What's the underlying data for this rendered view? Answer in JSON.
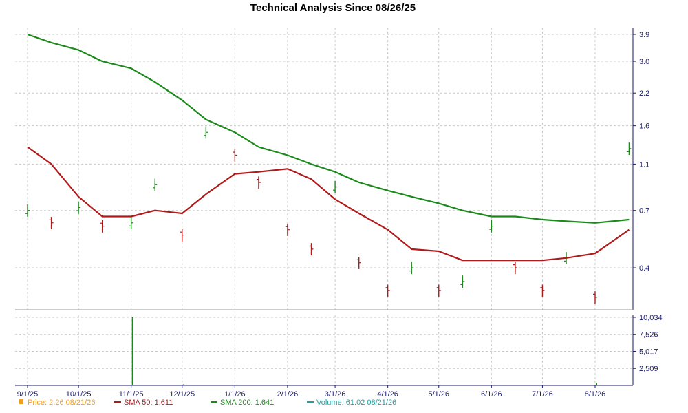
{
  "chart_data": {
    "type": "line",
    "title": "Technical Analysis Since 08/26/25",
    "price_axis": {
      "scale": "log",
      "ticks": [
        {
          "value": 0.4,
          "label": "0.4"
        },
        {
          "value": 0.7,
          "label": "0.7"
        },
        {
          "value": 1.1,
          "label": "1.1"
        },
        {
          "value": 1.6,
          "label": "1.6"
        },
        {
          "value": 2.2,
          "label": "2.2"
        },
        {
          "value": 3.0,
          "label": "3.0"
        },
        {
          "value": 3.9,
          "label": "3.9"
        }
      ]
    },
    "volume_axis": {
      "ticks": [
        {
          "value": 2509,
          "label": "2,509"
        },
        {
          "value": 5017,
          "label": "5,017"
        },
        {
          "value": 7526,
          "label": "7,526"
        },
        {
          "value": 10034,
          "label": "10,034"
        }
      ]
    },
    "date_axis": {
      "ticks": [
        "9/1/25",
        "10/1/25",
        "11/1/25",
        "12/1/25",
        "1/1/26",
        "2/1/26",
        "3/1/26",
        "4/1/26",
        "5/1/26",
        "6/1/26",
        "7/1/26",
        "8/1/26"
      ]
    },
    "series": [
      {
        "name": "SMA 200",
        "color": "#1a8a1a",
        "x": [
          "9/1/25",
          "9/15/25",
          "10/1/25",
          "10/15/25",
          "11/1/25",
          "11/15/25",
          "12/1/25",
          "12/15/25",
          "1/1/26",
          "1/15/26",
          "2/1/26",
          "2/15/26",
          "3/1/26",
          "3/15/26",
          "4/1/26",
          "4/15/26",
          "5/1/26",
          "5/15/26",
          "6/1/26",
          "6/15/26",
          "7/1/26",
          "7/15/26",
          "8/1/26",
          "8/21/26"
        ],
        "values": [
          3.9,
          3.6,
          3.35,
          3.0,
          2.8,
          2.45,
          2.05,
          1.7,
          1.5,
          1.3,
          1.2,
          1.1,
          1.02,
          0.92,
          0.85,
          0.8,
          0.75,
          0.7,
          0.66,
          0.66,
          0.64,
          0.63,
          0.62,
          0.64
        ]
      },
      {
        "name": "SMA 50",
        "color": "#b01a1a",
        "x": [
          "9/1/25",
          "9/15/25",
          "10/1/25",
          "10/15/25",
          "11/1/25",
          "11/15/25",
          "12/1/25",
          "12/15/25",
          "1/1/26",
          "1/15/26",
          "2/1/26",
          "2/15/26",
          "3/1/26",
          "3/15/26",
          "4/1/26",
          "4/15/26",
          "5/1/26",
          "5/15/26",
          "6/1/26",
          "6/15/26",
          "7/1/26",
          "7/15/26",
          "8/1/26",
          "8/21/26"
        ],
        "values": [
          1.3,
          1.1,
          0.8,
          0.66,
          0.66,
          0.7,
          0.68,
          0.82,
          1.0,
          1.02,
          1.05,
          0.95,
          0.78,
          0.68,
          0.58,
          0.48,
          0.47,
          0.43,
          0.43,
          0.43,
          0.43,
          0.44,
          0.46,
          0.58
        ]
      }
    ],
    "price_bars": {
      "up_color": "#1a8a1a",
      "down_color": "#b01a1a",
      "x": [
        "9/1/25",
        "9/15/25",
        "10/1/25",
        "10/15/25",
        "11/1/25",
        "11/15/25",
        "12/1/25",
        "12/15/25",
        "1/1/26",
        "1/15/26",
        "2/1/26",
        "2/15/26",
        "3/1/26",
        "3/15/26",
        "4/1/26",
        "4/15/26",
        "5/1/26",
        "5/15/26",
        "6/1/26",
        "6/15/26",
        "7/1/26",
        "7/15/26",
        "8/1/26",
        "8/21/26"
      ],
      "values": [
        0.7,
        0.62,
        0.72,
        0.6,
        0.62,
        0.9,
        0.55,
        1.5,
        1.2,
        0.92,
        0.58,
        0.48,
        0.88,
        0.42,
        0.32,
        0.4,
        0.32,
        0.35,
        0.6,
        0.4,
        0.32,
        0.44,
        0.3,
        1.28
      ]
    },
    "volume": {
      "color": "#1a8a1a",
      "x": [
        "9/1/25",
        "10/1/25",
        "11/1/25",
        "12/1/25",
        "1/1/26",
        "2/1/26",
        "3/1/26",
        "4/1/26",
        "5/1/26",
        "6/1/26",
        "7/1/26",
        "8/1/26"
      ],
      "values": [
        80,
        60,
        10034,
        150,
        90,
        70,
        100,
        80,
        90,
        60,
        110,
        400
      ]
    },
    "legend": [
      {
        "label": "Price: 2.26  08/21/26",
        "color": "#f0a020",
        "marker": "square"
      },
      {
        "label": "SMA 50: 1.611",
        "color": "#b01a1a",
        "marker": "line"
      },
      {
        "label": "SMA 200: 1.641",
        "color": "#1a8a1a",
        "marker": "line"
      },
      {
        "label": "Volume: 61.02  08/21/26",
        "color": "#20a0a0",
        "marker": "line"
      }
    ],
    "grid": true
  }
}
